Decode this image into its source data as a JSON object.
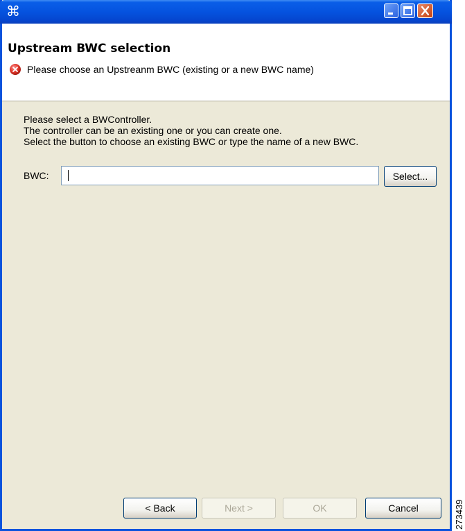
{
  "window": {
    "app_icon": "⌘",
    "controls": [
      "minimize-icon",
      "maximize-icon",
      "close-icon"
    ]
  },
  "header": {
    "title": "Upstream BWC selection",
    "message": "Please choose an Upstreanm BWC (existing or a new BWC name)",
    "message_icon": "error-icon"
  },
  "content": {
    "description": [
      "Please select a BWController.",
      "The controller can be an existing one or you can create one.",
      "Select the button to choose an existing BWC or type the name of a new BWC."
    ],
    "bwc_label": "BWC:",
    "bwc_value": "",
    "select_label": "Select..."
  },
  "footer": {
    "back_label": "< Back",
    "next_label": "Next >",
    "ok_label": "OK",
    "cancel_label": "Cancel"
  },
  "figure_number": "273439"
}
